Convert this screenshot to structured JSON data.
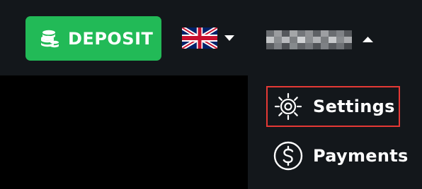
{
  "header": {
    "deposit_button": {
      "label": "DEPOSIT",
      "icon": "coins-icon",
      "color": "#22ba57"
    },
    "language": {
      "flag": "uk-flag-icon",
      "caret": "caret-down-icon"
    },
    "user_menu": {
      "caret": "caret-up-icon"
    }
  },
  "dropdown": {
    "items": [
      {
        "label": "Settings",
        "icon": "settings-icon",
        "highlighted": true
      },
      {
        "label": "Payments",
        "icon": "dollar-circle-icon",
        "highlighted": false
      }
    ]
  },
  "colors": {
    "header_bg": "#13171b",
    "page_bg": "#000000",
    "text": "#ffffff",
    "highlight_border": "#e53935"
  }
}
